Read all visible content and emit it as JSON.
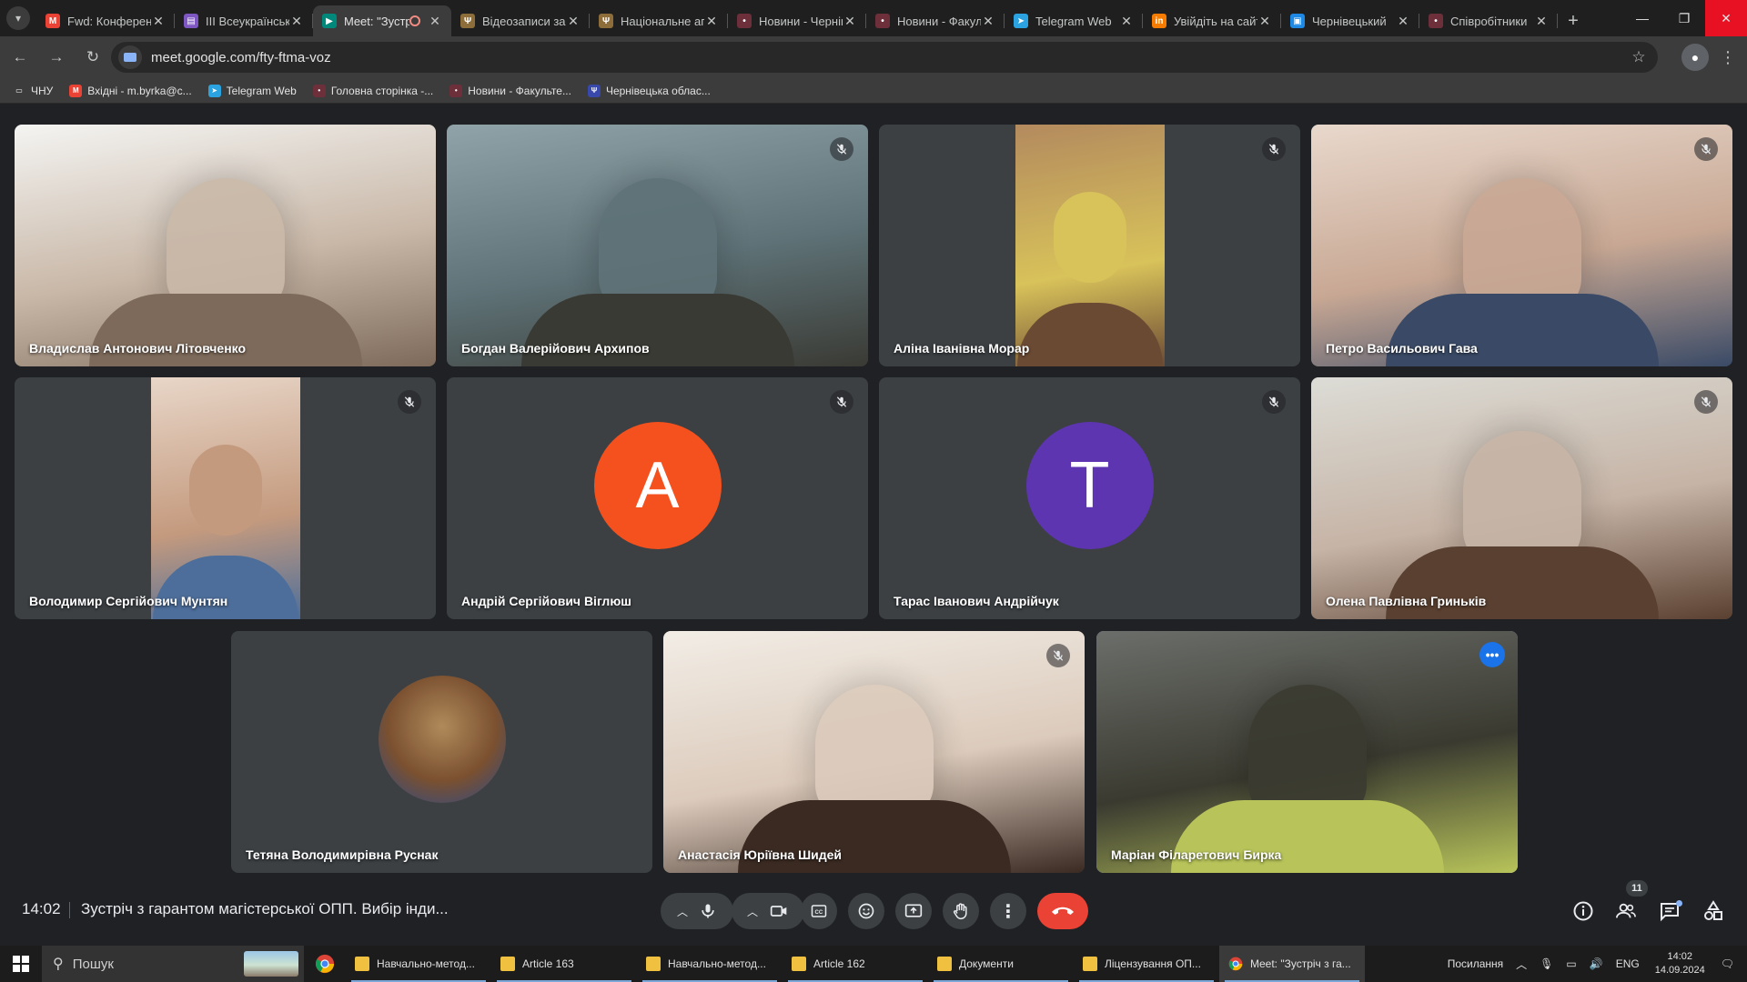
{
  "browser": {
    "tabs": [
      {
        "label": "Fwd: Конференція",
        "fav_color": "#ea4335",
        "fav_glyph": "M",
        "active": false
      },
      {
        "label": "III Всеукраїнська",
        "fav_color": "#7e57c2",
        "fav_glyph": "▤",
        "active": false
      },
      {
        "label": "Meet: \"Зустріч з гарантом\"",
        "fav_color": "#00897b",
        "fav_glyph": "▶",
        "active": true
      },
      {
        "label": "Відеозаписи засідань",
        "fav_color": "#8d6e3a",
        "fav_glyph": "Ψ",
        "active": false
      },
      {
        "label": "Національне агентство",
        "fav_color": "#8d6e3a",
        "fav_glyph": "Ψ",
        "active": false
      },
      {
        "label": "Новини - Чернівецький",
        "fav_color": "#6d2f3a",
        "fav_glyph": "•",
        "active": false
      },
      {
        "label": "Новини - Факультет",
        "fav_color": "#6d2f3a",
        "fav_glyph": "•",
        "active": false
      },
      {
        "label": "Telegram Web",
        "fav_color": "#2aa3e0",
        "fav_glyph": "➤",
        "active": false
      },
      {
        "label": "Увійдіть на сайт",
        "fav_color": "#f57c00",
        "fav_glyph": "in",
        "active": false
      },
      {
        "label": "Чернівецький",
        "fav_color": "#1e88e5",
        "fav_glyph": "▣",
        "active": false
      },
      {
        "label": "Співробітники",
        "fav_color": "#6d2f3a",
        "fav_glyph": "•",
        "active": false
      }
    ],
    "url": "meet.google.com/fty-ftma-voz",
    "bookmarks": [
      {
        "label": "ЧНУ",
        "fav_color": "#3c3c3c",
        "fav_glyph": "▭"
      },
      {
        "label": "Вхідні - m.byrka@c...",
        "fav_color": "#ea4335",
        "fav_glyph": "M"
      },
      {
        "label": "Telegram Web",
        "fav_color": "#2aa3e0",
        "fav_glyph": "➤"
      },
      {
        "label": "Головна сторінка -...",
        "fav_color": "#6d2f3a",
        "fav_glyph": "•"
      },
      {
        "label": "Новини - Факульте...",
        "fav_color": "#6d2f3a",
        "fav_glyph": "•"
      },
      {
        "label": "Чернівецька облас...",
        "fav_color": "#3949ab",
        "fav_glyph": "Ψ"
      }
    ]
  },
  "meet": {
    "participants": [
      {
        "name": "Владислав Антонович Літовченко",
        "muted": false,
        "kind": "video",
        "palette": [
          "#f4f4f2",
          "#c9b8a8",
          "#7d6a5a"
        ]
      },
      {
        "name": "Богдан Валерійович Архипов",
        "muted": true,
        "kind": "video",
        "palette": [
          "#8fa3a9",
          "#5e7277",
          "#3a3a34"
        ]
      },
      {
        "name": "Аліна Іванівна Морар",
        "muted": true,
        "kind": "video-narrow",
        "palette": [
          "#b38a5e",
          "#d8c25a",
          "#6b4a34"
        ]
      },
      {
        "name": "Петро Васильович Гава",
        "muted": true,
        "kind": "video",
        "palette": [
          "#e8d8cc",
          "#c8a894",
          "#3a4a66"
        ]
      },
      {
        "name": "Володимир Сергійович Мунтян",
        "muted": true,
        "kind": "video-narrow",
        "palette": [
          "#e8d6c8",
          "#c49a7e",
          "#4d6e9a"
        ]
      },
      {
        "name": "Андрій Сергійович Віглюш",
        "muted": true,
        "kind": "avatar",
        "initial": "А",
        "avatar_color": "#f4511e"
      },
      {
        "name": "Тарас Іванович Андрійчук",
        "muted": true,
        "kind": "avatar",
        "initial": "Т",
        "avatar_color": "#5e35b1"
      },
      {
        "name": "Олена Павлівна Гриньків",
        "muted": true,
        "kind": "video",
        "palette": [
          "#dcdcd6",
          "#c6b4a6",
          "#5a4030"
        ]
      },
      {
        "name": "Тетяна Володимирівна Руснак",
        "muted": false,
        "kind": "photo-avatar",
        "palette": [
          "#b08a5a",
          "#7a5030",
          "#2a4a8a"
        ]
      },
      {
        "name": "Анастасія Юріївна Шидей",
        "muted": true,
        "kind": "video",
        "palette": [
          "#f2ede6",
          "#dccbbc",
          "#3a2a22"
        ]
      },
      {
        "name": "Маріан Філаретович Бирка",
        "muted": false,
        "kind": "video",
        "speaking": true,
        "palette": [
          "#6b6e6a",
          "#3a3a30",
          "#b8c45a"
        ]
      }
    ],
    "clock": "14:02",
    "title": "Зустріч з гарантом магістерської ОПП. Вибір інди...",
    "participant_count": "11"
  },
  "taskbar": {
    "search_placeholder": "Пошук",
    "apps": [
      {
        "label": "Навчально-метод...",
        "active": false
      },
      {
        "label": "Article 163",
        "active": false
      },
      {
        "label": "Навчально-метод...",
        "active": false
      },
      {
        "label": "Article 162",
        "active": false
      },
      {
        "label": "Документи",
        "active": false
      },
      {
        "label": "Ліцензування ОП...",
        "active": false
      },
      {
        "label": "Meet: \"Зустріч з га...",
        "active": true
      }
    ],
    "tray_label": "Посилання",
    "lang": "ENG",
    "time": "14:02",
    "date": "14.09.2024"
  },
  "colors": {
    "accent": "#8ab4f8",
    "end_call": "#ea4335",
    "speaking_outline": "#8ab4f8"
  }
}
